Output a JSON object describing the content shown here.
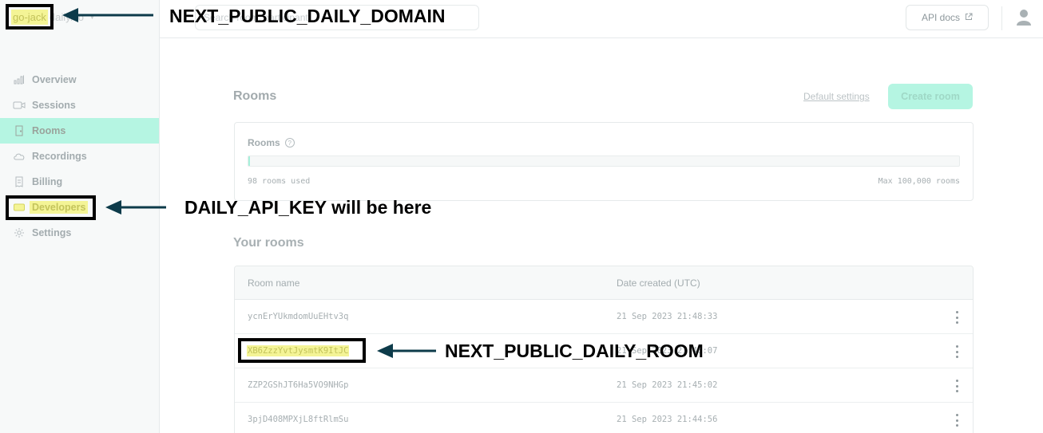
{
  "sidebar": {
    "domain": {
      "name": "go-jack",
      "suffix": "daily.co"
    },
    "items": [
      {
        "label": "Overview",
        "icon": "bar-chart-icon"
      },
      {
        "label": "Sessions",
        "icon": "video-camera-icon"
      },
      {
        "label": "Rooms",
        "icon": "door-icon",
        "active": true
      },
      {
        "label": "Recordings",
        "icon": "cloud-icon"
      },
      {
        "label": "Billing",
        "icon": "receipt-icon"
      },
      {
        "label": "Developers",
        "icon": "terminal-icon",
        "highlighted": true
      },
      {
        "label": "Settings",
        "icon": "gear-icon"
      }
    ]
  },
  "topbar": {
    "search_text": "Search room, participant...",
    "api_docs_label": "API docs",
    "user_icon": "user-icon"
  },
  "rooms_section": {
    "heading": "Rooms",
    "default_settings_label": "Default settings",
    "create_room_label": "Create room"
  },
  "usage": {
    "title": "Rooms",
    "used_text": "98 rooms used",
    "max_text": "Max 100,000 rooms",
    "fill_fraction": 0.00098
  },
  "your_rooms": {
    "heading": "Your rooms",
    "columns": [
      "Room name",
      "Date created (UTC)"
    ],
    "rows": [
      {
        "name": "ycnErYUkmdomUuEHtv3q",
        "date": "21 Sep 2023 21:48:33"
      },
      {
        "name": "XB6ZzzYvtJysmtK9ItJC",
        "date": "21 Sep 2023 21:46:07",
        "highlighted": true
      },
      {
        "name": "ZZP2GShJT6Ha5VO9NHGp",
        "date": "21 Sep 2023 21:45:02"
      },
      {
        "name": "3pjD408MPXjL8ftRlmSu",
        "date": "21 Sep 2023 21:44:56"
      }
    ]
  },
  "annotations": {
    "domain_note": "NEXT_PUBLIC_DAILY_DOMAIN",
    "api_key_note": "DAILY_API_KEY will be here",
    "room_note": "NEXT_PUBLIC_DAILY_ROOM"
  },
  "colors": {
    "accent": "#b5f5e2",
    "highlight": "#f4f496",
    "arrow": "#0d3b4a"
  }
}
